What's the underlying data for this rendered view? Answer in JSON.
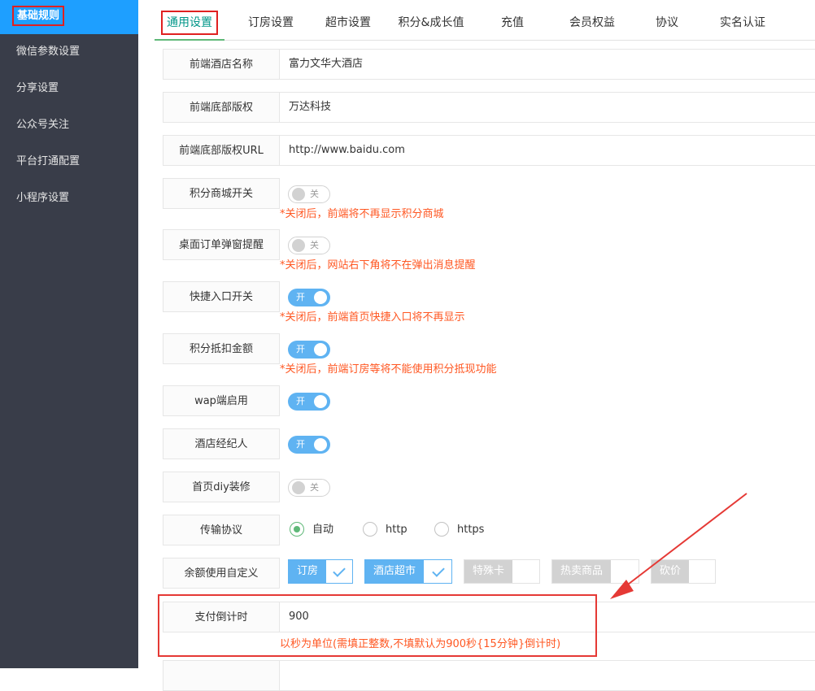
{
  "sidebar": {
    "items": [
      {
        "label": "基础规则",
        "active": true
      },
      {
        "label": "微信参数设置"
      },
      {
        "label": "分享设置"
      },
      {
        "label": "公众号关注"
      },
      {
        "label": "平台打通配置"
      },
      {
        "label": "小程序设置"
      }
    ]
  },
  "tabs": [
    "通用设置",
    "订房设置",
    "超市设置",
    "积分&成长值",
    "充值",
    "会员权益",
    "协议",
    "实名认证"
  ],
  "form": {
    "hotel_name": {
      "label": "前端酒店名称",
      "value": "富力文华大酒店"
    },
    "copyright": {
      "label": "前端底部版权",
      "value": "万达科技"
    },
    "copyright_url": {
      "label": "前端底部版权URL",
      "value": "http://www.baidu.com"
    },
    "points_mall": {
      "label": "积分商城开关",
      "state": "关",
      "hint": "*关闭后，前端将不再显示积分商城"
    },
    "order_popup": {
      "label": "桌面订单弹窗提醒",
      "state": "关",
      "hint": "*关闭后，网站右下角将不在弹出消息提醒"
    },
    "quick_entry": {
      "label": "快捷入口开关",
      "state": "开",
      "hint": "*关闭后，前端首页快捷入口将不再显示"
    },
    "points_deduct": {
      "label": "积分抵扣金额",
      "state": "开",
      "hint": "*关闭后，前端订房等将不能使用积分抵现功能"
    },
    "wap": {
      "label": "wap端启用",
      "state": "开"
    },
    "broker": {
      "label": "酒店经纪人",
      "state": "开"
    },
    "diy": {
      "label": "首页diy装修",
      "state": "关"
    },
    "protocol": {
      "label": "传输协议",
      "options": [
        "自动",
        "http",
        "https"
      ],
      "selected": "自动"
    },
    "balance": {
      "label": "余额使用自定义",
      "options": [
        {
          "label": "订房",
          "checked": true
        },
        {
          "label": "酒店超市",
          "checked": true
        },
        {
          "label": "特殊卡",
          "checked": false
        },
        {
          "label": "热卖商品",
          "checked": false
        },
        {
          "label": "砍价",
          "checked": false
        }
      ]
    },
    "countdown": {
      "label": "支付倒计时",
      "value": "900",
      "hint": "以秒为单位(需填正整数,不填默认为900秒{15分钟}倒计时)"
    }
  },
  "colors": {
    "sidebar_bg": "#393d49",
    "sidebar_active": "#1e9fff",
    "switch_on": "#5fb3f2",
    "hint": "#ff5722",
    "annotation": "#e53935"
  }
}
